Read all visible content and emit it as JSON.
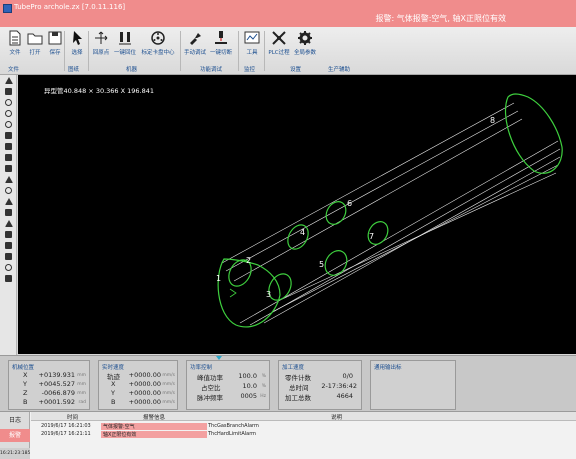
{
  "window": {
    "title": "TubePro archole.zx [7.0.11.116]",
    "alarm_text": "报警: 气体报警:空气, 轴X正限位有效"
  },
  "ribbon": {
    "buttons": [
      {
        "label": "文件",
        "icon": "document-icon"
      },
      {
        "label": "打开",
        "icon": "folder-open-icon"
      },
      {
        "label": "保存",
        "icon": "save-icon"
      },
      {
        "label": "选择",
        "icon": "cursor-icon"
      },
      {
        "label": "回原点",
        "icon": "home-axis-icon"
      },
      {
        "label": "一键回位",
        "icon": "one-key-return-icon"
      },
      {
        "label": "标定卡盘中心",
        "icon": "chuck-center-icon"
      },
      {
        "label": "手动调试",
        "icon": "manual-debug-icon"
      },
      {
        "label": "一键切断",
        "icon": "one-key-cut-icon"
      },
      {
        "label": "工具",
        "icon": "tools-icon"
      },
      {
        "label": "PLC过程",
        "icon": "plc-process-icon"
      },
      {
        "label": "全局参数",
        "icon": "global-params-icon"
      }
    ],
    "groups": [
      "文件",
      "图纸",
      "机器",
      "功能调试",
      "监控",
      "设置",
      "生产辅助"
    ]
  },
  "left_tools": [
    "pointer-icon",
    "hand-icon",
    "eye-icon",
    "magnifier-icon",
    "circle-icon",
    "polygon-icon",
    "rectangle-icon",
    "layer-icon",
    "line-icon",
    "flip-icon",
    "drop-icon",
    "node-icon",
    "cross-icon",
    "triangle-icon",
    "pen-icon",
    "grid-icon",
    "array-icon",
    "lead-icon",
    "measure-icon"
  ],
  "canvas": {
    "part_info": "异型管40.848 × 30.366 X 196.841",
    "background": "#000000",
    "part_color": "#3ecf3e",
    "hole_labels": [
      "1",
      "2",
      "3",
      "4",
      "5",
      "6",
      "7",
      "8"
    ]
  },
  "panels": {
    "machine_pos": {
      "title": "机械位置",
      "rows": [
        {
          "axis": "X",
          "value": "+0139.931",
          "unit": "mm"
        },
        {
          "axis": "Y",
          "value": "+0045.527",
          "unit": "mm"
        },
        {
          "axis": "Z",
          "value": "-0066.879",
          "unit": "mm"
        },
        {
          "axis": "B",
          "value": "+0001.592",
          "unit": "rad"
        }
      ]
    },
    "speed": {
      "title": "实时速度",
      "rows": [
        {
          "axis": "轨迹",
          "value": "+0000.00",
          "unit": "mm/s"
        },
        {
          "axis": "X",
          "value": "+0000.00",
          "unit": "mm/s"
        },
        {
          "axis": "Y",
          "value": "+0000.00",
          "unit": "mm/s"
        },
        {
          "axis": "B",
          "value": "+0000.00",
          "unit": "mm/s"
        }
      ]
    },
    "power": {
      "title": "功率控制",
      "rows": [
        {
          "label": "峰值功率",
          "value": "100.0",
          "unit": "%"
        },
        {
          "label": "占空比",
          "value": "10.0",
          "unit": "%"
        },
        {
          "label": "脉冲频率",
          "value": "0005",
          "unit": "Hz"
        }
      ]
    },
    "process": {
      "title": "加工速度",
      "rows": [
        {
          "label": "零件计数",
          "value": "0/0"
        },
        {
          "label": "总时间",
          "value": "2-17:36:42"
        },
        {
          "label": "加工总数",
          "value": "4664"
        }
      ]
    },
    "io": {
      "title": "通用输出标"
    }
  },
  "log": {
    "tabs": [
      "日志",
      "报警"
    ],
    "active_tab": 1,
    "headers": [
      "时间",
      "报警信息",
      "说明"
    ],
    "rows": [
      {
        "time": "2019/6/17 16:21:03",
        "info": "气体报警:空气",
        "desc": "ThcGasBranchAlarm"
      },
      {
        "time": "2019/6/17 16:21:11",
        "info": "轴X正限位有效",
        "desc": "ThcHardLimitAlarm"
      }
    ],
    "clock": "16:21:23:185"
  }
}
